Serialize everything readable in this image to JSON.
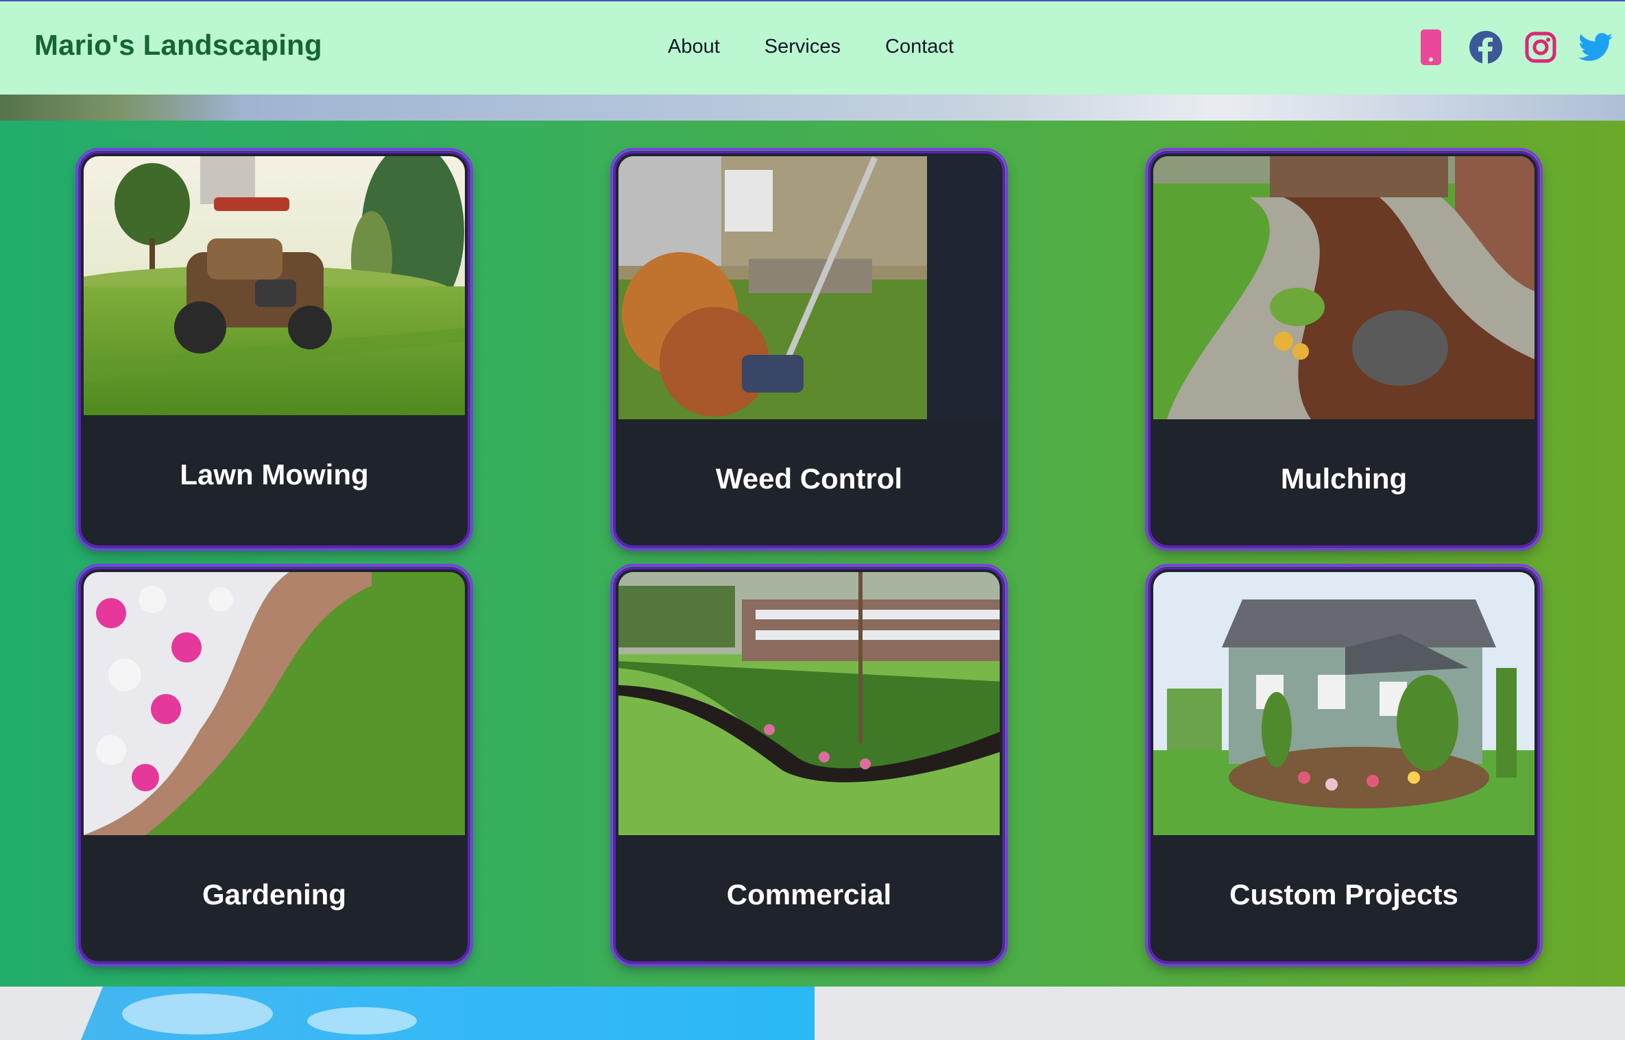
{
  "brand": {
    "name": "Mario's Landscaping",
    "color": "#166534"
  },
  "nav": {
    "items": [
      {
        "label": "About"
      },
      {
        "label": "Services"
      },
      {
        "label": "Contact"
      }
    ]
  },
  "social": [
    {
      "name": "phone-icon",
      "color": "#ec4899"
    },
    {
      "name": "facebook-icon",
      "color": "#3b5998"
    },
    {
      "name": "instagram-icon",
      "color": "#db2777"
    },
    {
      "name": "twitter-icon",
      "color": "#1da1f2"
    }
  ],
  "colors": {
    "header_bg": "#bbf7d0",
    "card_bg": "#1f232b",
    "card_border": "#6d28d9"
  },
  "services": [
    {
      "title": "Lawn Mowing",
      "image": "lawn-mower-photo"
    },
    {
      "title": "Weed Control",
      "image": "string-trimmer-photo"
    },
    {
      "title": "Mulching",
      "image": "mulch-bed-photo"
    },
    {
      "title": "Gardening",
      "image": "flower-bed-photo"
    },
    {
      "title": "Commercial",
      "image": "commercial-landscape-photo"
    },
    {
      "title": "Custom Projects",
      "image": "house-yard-design-photo"
    }
  ]
}
